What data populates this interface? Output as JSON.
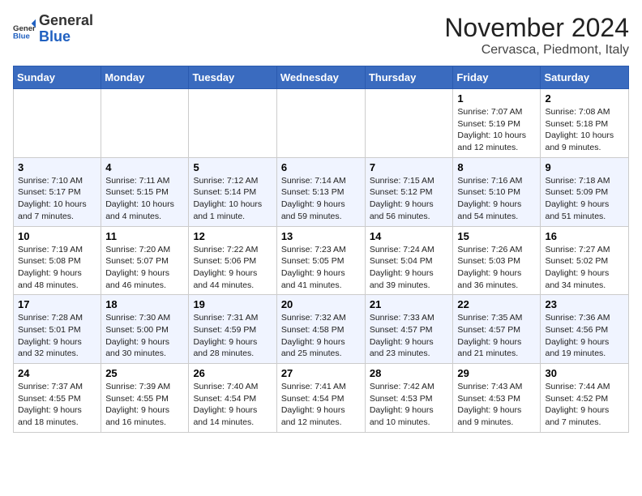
{
  "header": {
    "logo_general": "General",
    "logo_blue": "Blue",
    "month_title": "November 2024",
    "location": "Cervasca, Piedmont, Italy"
  },
  "weekdays": [
    "Sunday",
    "Monday",
    "Tuesday",
    "Wednesday",
    "Thursday",
    "Friday",
    "Saturday"
  ],
  "weeks": [
    [
      {
        "day": "",
        "info": ""
      },
      {
        "day": "",
        "info": ""
      },
      {
        "day": "",
        "info": ""
      },
      {
        "day": "",
        "info": ""
      },
      {
        "day": "",
        "info": ""
      },
      {
        "day": "1",
        "info": "Sunrise: 7:07 AM\nSunset: 5:19 PM\nDaylight: 10 hours and 12 minutes."
      },
      {
        "day": "2",
        "info": "Sunrise: 7:08 AM\nSunset: 5:18 PM\nDaylight: 10 hours and 9 minutes."
      }
    ],
    [
      {
        "day": "3",
        "info": "Sunrise: 7:10 AM\nSunset: 5:17 PM\nDaylight: 10 hours and 7 minutes."
      },
      {
        "day": "4",
        "info": "Sunrise: 7:11 AM\nSunset: 5:15 PM\nDaylight: 10 hours and 4 minutes."
      },
      {
        "day": "5",
        "info": "Sunrise: 7:12 AM\nSunset: 5:14 PM\nDaylight: 10 hours and 1 minute."
      },
      {
        "day": "6",
        "info": "Sunrise: 7:14 AM\nSunset: 5:13 PM\nDaylight: 9 hours and 59 minutes."
      },
      {
        "day": "7",
        "info": "Sunrise: 7:15 AM\nSunset: 5:12 PM\nDaylight: 9 hours and 56 minutes."
      },
      {
        "day": "8",
        "info": "Sunrise: 7:16 AM\nSunset: 5:10 PM\nDaylight: 9 hours and 54 minutes."
      },
      {
        "day": "9",
        "info": "Sunrise: 7:18 AM\nSunset: 5:09 PM\nDaylight: 9 hours and 51 minutes."
      }
    ],
    [
      {
        "day": "10",
        "info": "Sunrise: 7:19 AM\nSunset: 5:08 PM\nDaylight: 9 hours and 48 minutes."
      },
      {
        "day": "11",
        "info": "Sunrise: 7:20 AM\nSunset: 5:07 PM\nDaylight: 9 hours and 46 minutes."
      },
      {
        "day": "12",
        "info": "Sunrise: 7:22 AM\nSunset: 5:06 PM\nDaylight: 9 hours and 44 minutes."
      },
      {
        "day": "13",
        "info": "Sunrise: 7:23 AM\nSunset: 5:05 PM\nDaylight: 9 hours and 41 minutes."
      },
      {
        "day": "14",
        "info": "Sunrise: 7:24 AM\nSunset: 5:04 PM\nDaylight: 9 hours and 39 minutes."
      },
      {
        "day": "15",
        "info": "Sunrise: 7:26 AM\nSunset: 5:03 PM\nDaylight: 9 hours and 36 minutes."
      },
      {
        "day": "16",
        "info": "Sunrise: 7:27 AM\nSunset: 5:02 PM\nDaylight: 9 hours and 34 minutes."
      }
    ],
    [
      {
        "day": "17",
        "info": "Sunrise: 7:28 AM\nSunset: 5:01 PM\nDaylight: 9 hours and 32 minutes."
      },
      {
        "day": "18",
        "info": "Sunrise: 7:30 AM\nSunset: 5:00 PM\nDaylight: 9 hours and 30 minutes."
      },
      {
        "day": "19",
        "info": "Sunrise: 7:31 AM\nSunset: 4:59 PM\nDaylight: 9 hours and 28 minutes."
      },
      {
        "day": "20",
        "info": "Sunrise: 7:32 AM\nSunset: 4:58 PM\nDaylight: 9 hours and 25 minutes."
      },
      {
        "day": "21",
        "info": "Sunrise: 7:33 AM\nSunset: 4:57 PM\nDaylight: 9 hours and 23 minutes."
      },
      {
        "day": "22",
        "info": "Sunrise: 7:35 AM\nSunset: 4:57 PM\nDaylight: 9 hours and 21 minutes."
      },
      {
        "day": "23",
        "info": "Sunrise: 7:36 AM\nSunset: 4:56 PM\nDaylight: 9 hours and 19 minutes."
      }
    ],
    [
      {
        "day": "24",
        "info": "Sunrise: 7:37 AM\nSunset: 4:55 PM\nDaylight: 9 hours and 18 minutes."
      },
      {
        "day": "25",
        "info": "Sunrise: 7:39 AM\nSunset: 4:55 PM\nDaylight: 9 hours and 16 minutes."
      },
      {
        "day": "26",
        "info": "Sunrise: 7:40 AM\nSunset: 4:54 PM\nDaylight: 9 hours and 14 minutes."
      },
      {
        "day": "27",
        "info": "Sunrise: 7:41 AM\nSunset: 4:54 PM\nDaylight: 9 hours and 12 minutes."
      },
      {
        "day": "28",
        "info": "Sunrise: 7:42 AM\nSunset: 4:53 PM\nDaylight: 9 hours and 10 minutes."
      },
      {
        "day": "29",
        "info": "Sunrise: 7:43 AM\nSunset: 4:53 PM\nDaylight: 9 hours and 9 minutes."
      },
      {
        "day": "30",
        "info": "Sunrise: 7:44 AM\nSunset: 4:52 PM\nDaylight: 9 hours and 7 minutes."
      }
    ]
  ]
}
